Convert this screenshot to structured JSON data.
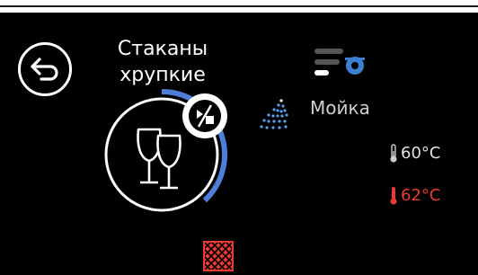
{
  "program": {
    "title_line1": "Стаканы",
    "title_line2": "хрупкие",
    "progress_fraction": 0.38
  },
  "phase": {
    "label": "Мойка",
    "icon": "spray-icon"
  },
  "temperatures": {
    "target": "60°C",
    "actual": "62°C"
  },
  "icons": {
    "back": "back-arrow-icon",
    "program": "wine-glasses-icon",
    "mode": "half-load-icon",
    "filter": "filter-status-icon",
    "alert": "grid-alert-icon"
  },
  "colors": {
    "background": "#000000",
    "progress": "#4d7fd8",
    "accent_blue": "#3a7fd0",
    "alert_red": "#e83a2e",
    "text": "#ffffff"
  }
}
